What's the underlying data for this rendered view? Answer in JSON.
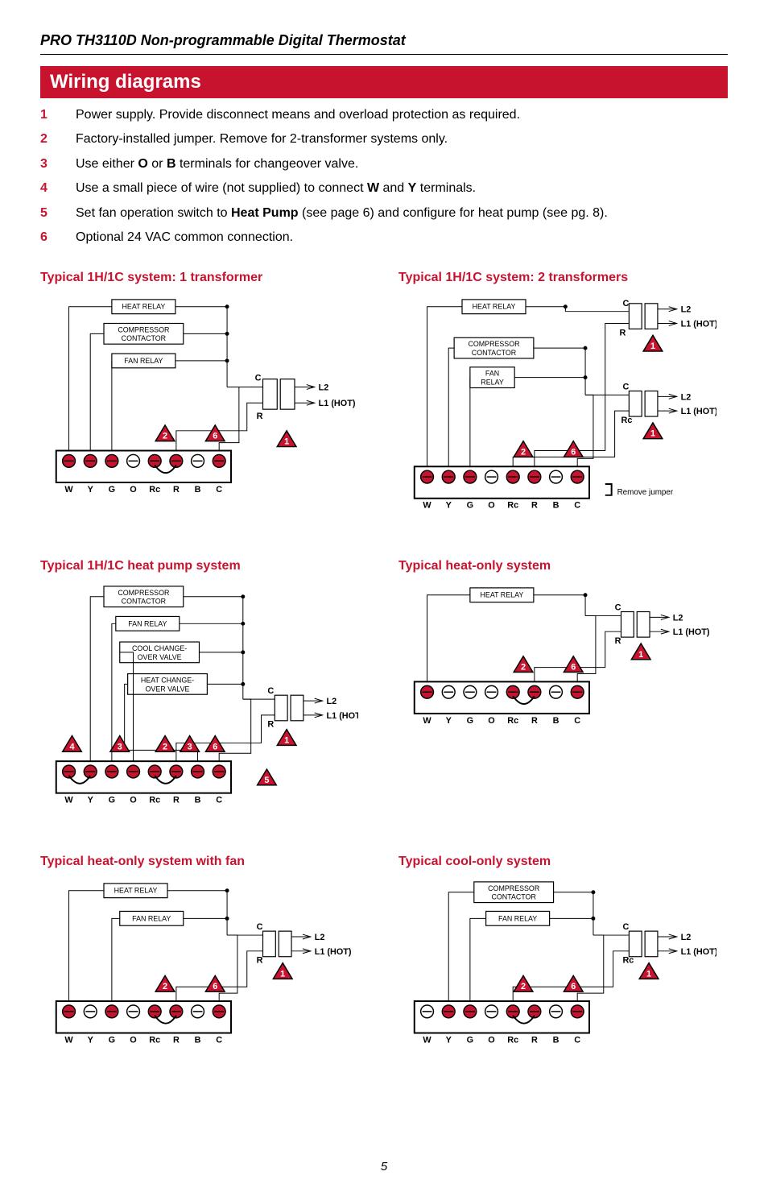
{
  "header": "PRO TH3110D Non-programmable Digital Thermostat",
  "banner": "Wiring diagrams",
  "notes": [
    {
      "n": "1",
      "t1": "Power supply. Provide disconnect means and overload protection as required."
    },
    {
      "n": "2",
      "t1": "Factory-installed jumper. Remove for 2-transformer systems only."
    },
    {
      "n": "3",
      "pre": "Use either ",
      "b1": "O",
      "mid": " or ",
      "b2": "B",
      "post": " terminals for changeover valve."
    },
    {
      "n": "4",
      "pre": "Use a small piece of wire (not supplied) to connect ",
      "b1": "W",
      "mid": " and ",
      "b2": "Y",
      "post": " terminals."
    },
    {
      "n": "5",
      "pre": "Set fan operation switch to ",
      "b1": "Heat Pump",
      "post": " (see page 6) and configure for heat pump (see pg. 8)."
    },
    {
      "n": "6",
      "t1": "Optional 24 VAC common connection."
    }
  ],
  "remove_jumper": "Remove jumper",
  "comp": {
    "heat": "HEAT RELAY",
    "comp1": "COMPRESSOR",
    "comp2": "CONTACTOR",
    "fan1": "FAN RELAY",
    "fan": "FAN",
    "relay": "RELAY",
    "cool1": "COOL CHANGE-",
    "cool2": "OVER VALVE",
    "hc1": "HEAT CHANGE-",
    "hc2": "OVER VALVE"
  },
  "pwr": {
    "L2": "L2",
    "L1": "L1 (HOT)",
    "C": "C",
    "R": "R",
    "Rc": "Rc"
  },
  "term": [
    "W",
    "Y",
    "G",
    "O",
    "Rc",
    "R",
    "B",
    "C"
  ],
  "diagrams": [
    {
      "title": "Typical 1H/1C system: 1 transformer"
    },
    {
      "title": "Typical 1H/1C system: 2 transformers"
    },
    {
      "title": "Typical 1H/1C heat pump system"
    },
    {
      "title": "Typical heat-only system"
    },
    {
      "title": "Typical heat-only system with fan"
    },
    {
      "title": "Typical cool-only system"
    }
  ],
  "page": "5"
}
